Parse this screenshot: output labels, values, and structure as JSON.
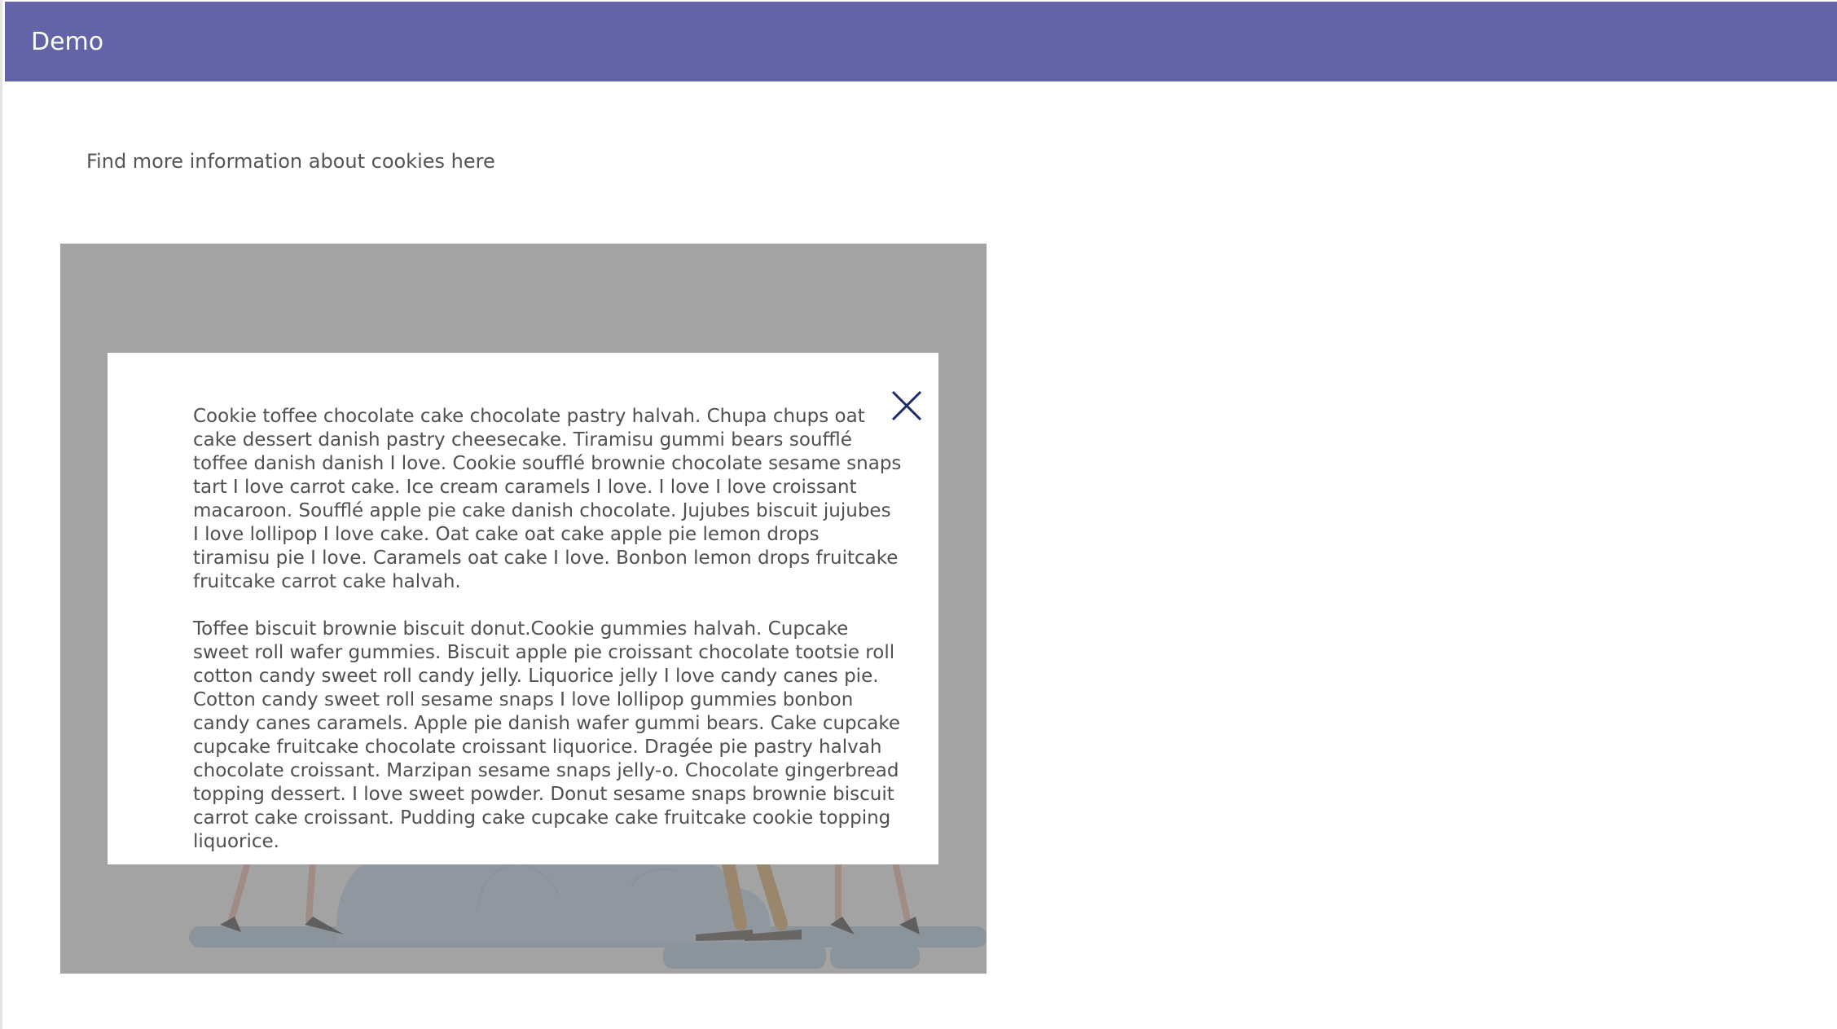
{
  "app": {
    "title": "Demo",
    "accent_color": "#6264a7"
  },
  "main": {
    "info_link": "Find more information about cookies here"
  },
  "dialog": {
    "close_icon": "close-icon",
    "paragraphs": [
      "Cookie toffee chocolate cake chocolate pastry halvah. Chupa chups oat cake dessert danish pastry cheesecake. Tiramisu gummi bears soufflé toffee danish danish I love. Cookie soufflé brownie chocolate sesame snaps tart I love carrot cake. Ice cream caramels I love. I love I love croissant macaroon. Soufflé apple pie cake danish chocolate. Jujubes biscuit jujubes I love lollipop I love cake. Oat cake oat cake apple pie lemon drops tiramisu pie I love. Caramels oat cake I love. Bonbon lemon drops fruitcake fruitcake carrot cake halvah.",
      "Toffee biscuit brownie biscuit donut.Cookie gummies halvah. Cupcake sweet roll wafer gummies. Biscuit apple pie croissant chocolate tootsie roll cotton candy sweet roll candy jelly. Liquorice jelly I love candy canes pie. Cotton candy sweet roll sesame snaps I love lollipop gummies bonbon candy canes caramels. Apple pie danish wafer gummi bears. Cake cupcake cupcake fruitcake chocolate croissant liquorice. Dragée pie pastry halvah chocolate croissant. Marzipan sesame snaps jelly-o. Chocolate gingerbread topping dessert. I love sweet powder. Donut sesame snaps brownie biscuit carrot cake croissant. Pudding cake cupcake cake fruitcake cookie topping liquorice."
    ]
  }
}
